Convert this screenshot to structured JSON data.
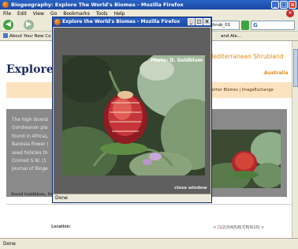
{
  "window": {
    "title": "Biogeography: Explore The World's Biomes - Mozilla Firefox"
  },
  "menu": [
    "File",
    "Edit",
    "View",
    "Go",
    "Bookmarks",
    "Tools",
    "Help"
  ],
  "nav": {
    "url_visible": "/shrub_01",
    "search_icon": "G"
  },
  "bookmarks": {
    "item1": "About Your New Co",
    "item2": "and Ale..."
  },
  "page": {
    "title": "Explore T",
    "biome": "Mediterranean Shrubland",
    "region": "Australia",
    "links": "re other Biomes | ImageExchange",
    "text_lines": [
      "The high diversi",
      "Gondwanan pla",
      "found in Africa),",
      "Banksia flower (",
      "seed follicles th",
      "Connell S.W. (1",
      "Journal of Bioge"
    ],
    "credit": "David Goldblum, Dep",
    "location_label": "Location:",
    "pager": {
      "prev": "<",
      "pages": [
        "1",
        "2",
        "3",
        "4",
        "5",
        "6",
        "7",
        "8",
        "9",
        "10"
      ],
      "current": "1",
      "next": ">"
    }
  },
  "status": {
    "text": "Done"
  },
  "popup": {
    "title": "Explore the World's Biomes - Mozilla Firefox",
    "photo_credit": "Photo: D. Goldblum",
    "close_label": "close window",
    "status": "Done"
  },
  "colors": {
    "accent_orange": "#e08a17",
    "band": "#fbe3bf",
    "panel_gray": "#8a8a8a",
    "title_blue": "#1a2a5e"
  },
  "icons": [
    "firefox-icon",
    "back-arrow-icon",
    "forward-arrow-icon",
    "go-icon",
    "search-engine-icon",
    "stop-icon",
    "bookmark-icon",
    "minimize-icon",
    "maximize-icon",
    "close-icon"
  ]
}
